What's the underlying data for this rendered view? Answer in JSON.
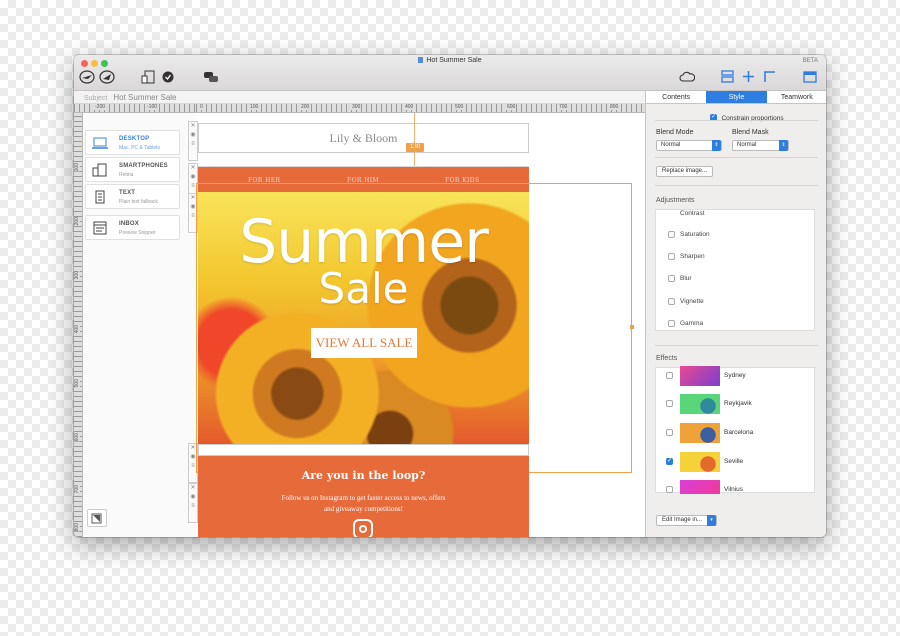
{
  "window": {
    "title": "Hot Summer Sale",
    "beta_label": "BETA"
  },
  "subject": {
    "label": "Subject",
    "value": "Hot Summer Sale"
  },
  "hruler": [
    "-200",
    "-100",
    "0",
    "100",
    "200",
    "300",
    "400",
    "500",
    "600",
    "700",
    "800"
  ],
  "vruler": [
    "100",
    "200",
    "300",
    "400",
    "500",
    "600",
    "700",
    "800"
  ],
  "devices": [
    {
      "name": "DESKTOP",
      "sub": "Mac, PC & Tablets",
      "icon": "laptop-icon",
      "selected": true
    },
    {
      "name": "SMARTPHONES",
      "sub": "Retina",
      "icon": "phone-icon",
      "selected": false
    },
    {
      "name": "TEXT",
      "sub": "Plain text fallback",
      "icon": "text-doc-icon",
      "selected": false
    },
    {
      "name": "INBOX",
      "sub": "Preview Snippet",
      "icon": "inbox-icon",
      "selected": false
    }
  ],
  "email": {
    "logo": "Lily & Bloom",
    "guide_label": "130",
    "nav": [
      "FOR HER",
      "FOR HIM",
      "FOR KIDS"
    ],
    "hero_title": "Summer",
    "hero_subtitle": "Sale",
    "hero_button": "VIEW ALL SALE",
    "loop_heading": "Are you in the loop?",
    "loop_text": "Follow us on Instagram to get faster access to news, offers and giveaway competitions!"
  },
  "panel": {
    "tabs": [
      "Contents",
      "Style",
      "Teamwork"
    ],
    "active_tab": "Style",
    "constrain": "Constrain proportions",
    "blend_mode_label": "Blend Mode",
    "blend_mode_value": "Normal",
    "blend_mask_label": "Blend Mask",
    "blend_mask_value": "Normal",
    "replace_button": "Replace image...",
    "adjustments_label": "Adjustments",
    "adjustments": [
      "Contrast",
      "Saturation",
      "Sharpen",
      "Blur",
      "Vignette",
      "Gamma"
    ],
    "effects_label": "Effects",
    "effects": [
      {
        "name": "Sydney",
        "checked": false,
        "colors": [
          "#e94a8f",
          "#7b3fd0"
        ]
      },
      {
        "name": "Reykjavik",
        "checked": false,
        "colors": [
          "#5ad67a",
          "#2f8a9e"
        ]
      },
      {
        "name": "Barcelona",
        "checked": false,
        "colors": [
          "#f0a23a",
          "#3b5fa0"
        ]
      },
      {
        "name": "Seville",
        "checked": true,
        "colors": [
          "#f6d23a",
          "#e46a2a"
        ]
      },
      {
        "name": "Vilnius",
        "checked": false,
        "colors": [
          "#d93fd6",
          "#f03a9c"
        ]
      }
    ],
    "edit_button": "Edit Image in..."
  },
  "colors": {
    "accent": "#2e7de1",
    "email_orange": "#e76a3b",
    "guide": "#f0a04b"
  }
}
